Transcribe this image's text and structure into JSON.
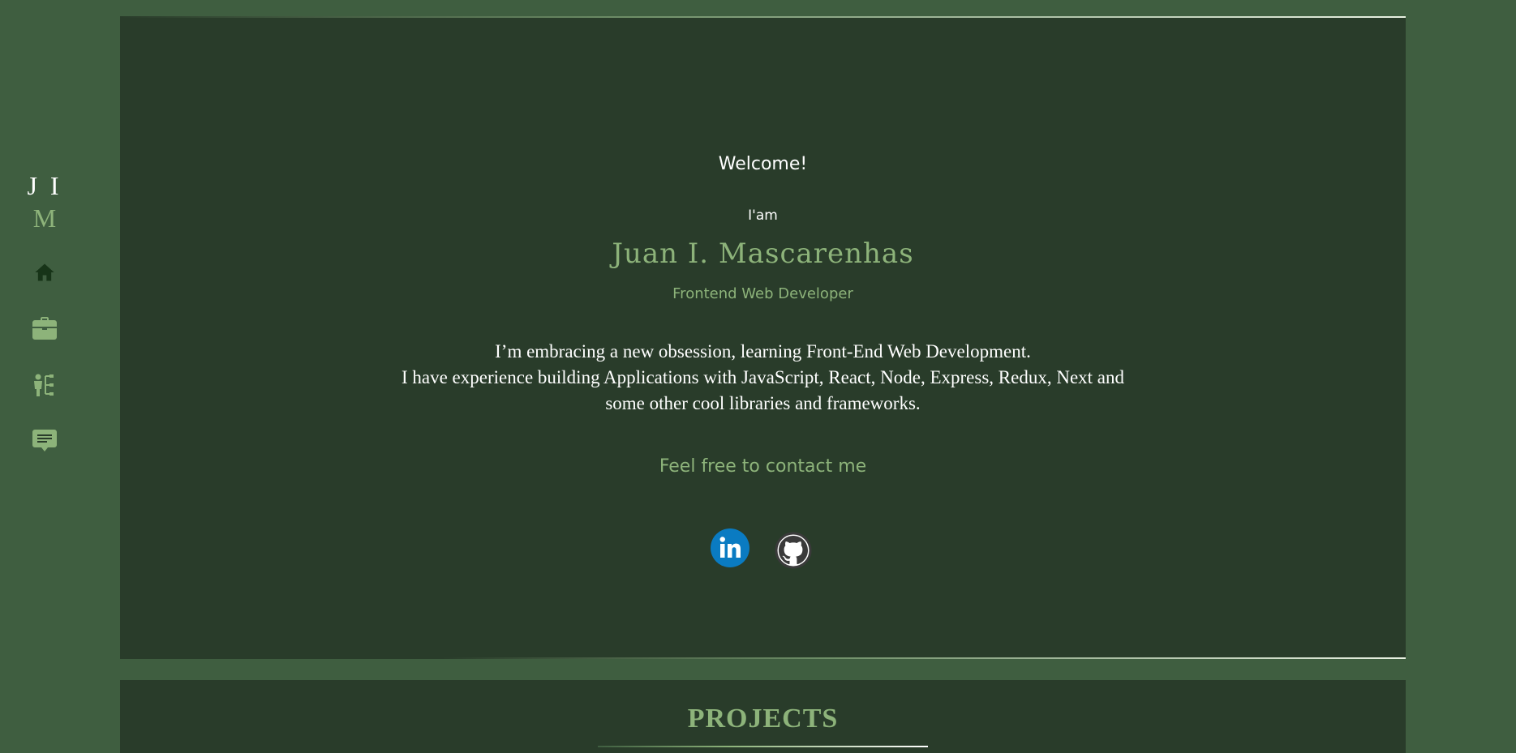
{
  "sidebar": {
    "logo": {
      "line1": "J I",
      "line2": "M"
    },
    "nav": [
      {
        "name": "home",
        "icon": "home-icon",
        "color": "#173418"
      },
      {
        "name": "projects",
        "icon": "briefcase-icon",
        "color": "#8db37a"
      },
      {
        "name": "about",
        "icon": "org-chart-person-icon",
        "color": "#8db37a"
      },
      {
        "name": "contact",
        "icon": "chat-icon",
        "color": "#8db37a"
      }
    ]
  },
  "hero": {
    "welcome": "Welcome!",
    "iam": "I'am",
    "name": "Juan I. Mascarenhas",
    "role": "Frontend Web Developer",
    "bio_line1": "I’m embracing a new obsession, learning Front-End Web Development.",
    "bio_line2": "I have experience building Applications with JavaScript, React, Node, Express, Redux, Next and some other cool libraries and frameworks.",
    "contact_cta": "Feel free to contact me",
    "social": [
      {
        "name": "linkedin",
        "icon": "linkedin-icon",
        "color": "#0a7bc2"
      },
      {
        "name": "github",
        "icon": "github-icon",
        "color": "#3a3a3a"
      }
    ]
  },
  "projects": {
    "title": "PROJECTS"
  },
  "colors": {
    "background": "#3f5e40",
    "panel": "#293c2a",
    "accent": "#8db37a",
    "text": "#ffffff"
  }
}
